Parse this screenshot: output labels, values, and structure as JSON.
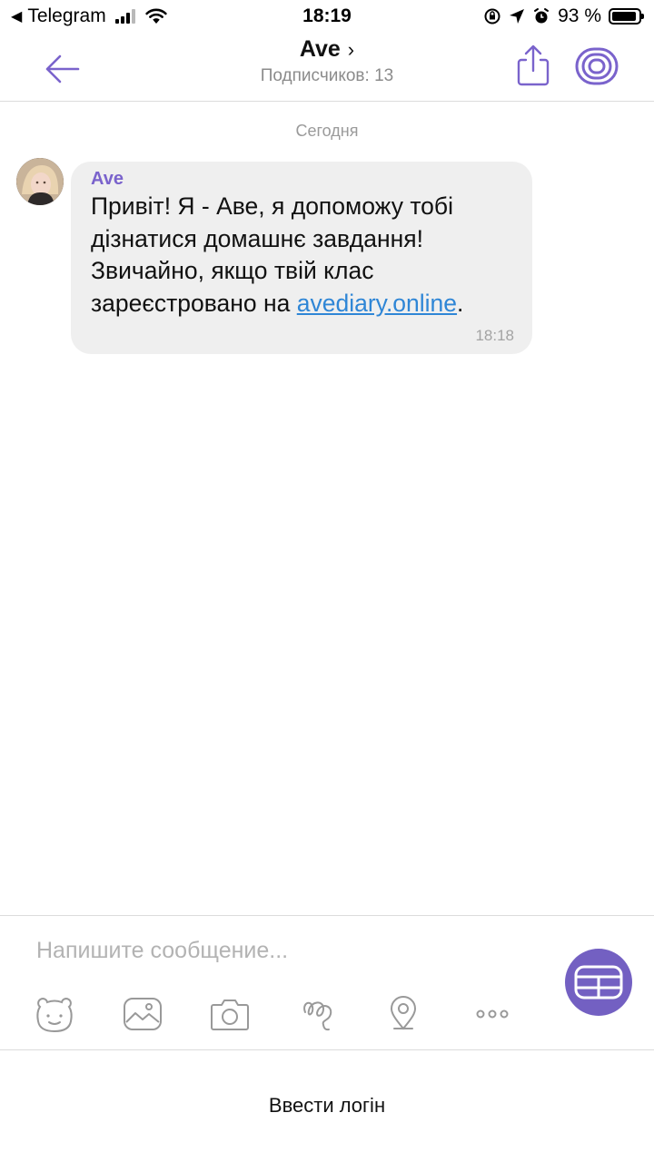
{
  "status_bar": {
    "back_app": "Telegram",
    "time": "18:19",
    "battery": "93 %",
    "battery_level": 0.93
  },
  "header": {
    "title": "Ave",
    "title_chevron": "›",
    "subtitle": "Подписчиков: 13",
    "back_icon": "arrow-left-icon",
    "share_icon": "share-icon",
    "channel_icon": "channel-icon"
  },
  "chat": {
    "date_separator": "Сегодня",
    "messages": [
      {
        "sender": "Ave",
        "text_before_link": "Привіт! Я - Аве, я допоможу тобі дізнатися домашнє завдання! Звичайно, якщо твій клас зареєстровано на ",
        "link": "avediary.online",
        "text_after_link": ".",
        "time": "18:18"
      }
    ]
  },
  "composer": {
    "placeholder": "Напишите сообщение...",
    "toolbar": [
      "sticker-icon",
      "gallery-icon",
      "camera-icon",
      "doodle-icon",
      "location-icon",
      "more-icon"
    ],
    "send_icon": "keyboard-grid-icon"
  },
  "bottom": {
    "login_label": "Ввести логін"
  },
  "colors": {
    "accent": "#7360c2",
    "sender": "#7a63cc",
    "link": "#2f86d6",
    "bubble": "#efefef",
    "muted": "#9a9a9a"
  }
}
